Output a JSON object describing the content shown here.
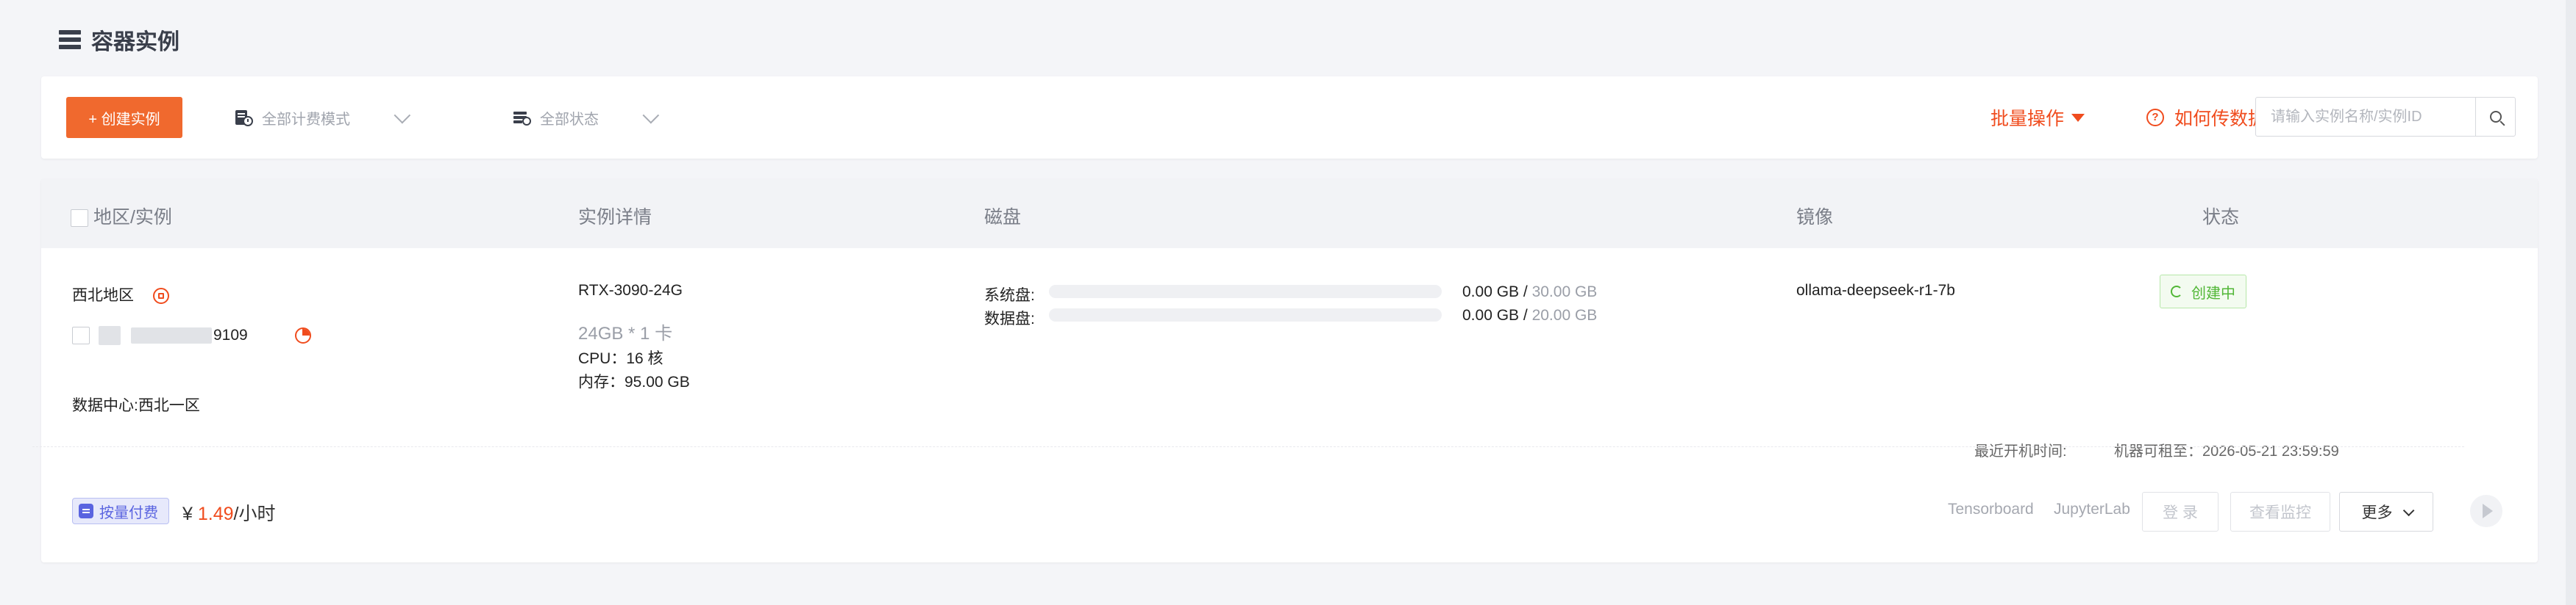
{
  "page": {
    "title": "容器实例"
  },
  "toolbar": {
    "create_label": "+ 创建实例",
    "billing_filter": "全部计费模式",
    "status_filter": "全部状态",
    "batch_label": "批量操作",
    "howto_label": "如何传数据",
    "search_placeholder": "请输入实例名称/实例ID",
    "icons": {
      "billing": "billing-filter-icon",
      "status": "status-filter-icon",
      "search": "search-icon"
    }
  },
  "table": {
    "headers": [
      "地区/实例",
      "实例详情",
      "磁盘",
      "镜像",
      "状态"
    ],
    "row": {
      "region": "西北地区",
      "instance_id_visible": "9109",
      "datacenter": "数据中心:西北一区",
      "gpu": "RTX-3090-24G",
      "gpu_spec": "24GB * 1 卡",
      "cpu": "CPU：16 核",
      "memory": "内存：95.00 GB",
      "disks": [
        {
          "label": "系统盘:",
          "used": "0.00 GB",
          "sep": " / ",
          "total": "30.00 GB",
          "usage": 0
        },
        {
          "label": "数据盘:",
          "used": "0.00 GB",
          "sep": " / ",
          "total": "20.00 GB",
          "usage": 0
        }
      ],
      "image": "ollama-deepseek-r1-7b",
      "status": "创建中",
      "last_boot_label": "最近开机时间:",
      "rent_until": "机器可租至：2026-05-21 23:59:59",
      "billing_badge": "按量付费",
      "price_prefix": "¥",
      "price_value": "1.49",
      "price_unit": "/小时",
      "actions": {
        "tensorboard": "Tensorboard",
        "jupyterlab": "JupyterLab",
        "login": "登 录",
        "monitor": "查看监控",
        "more": "更多"
      }
    }
  },
  "colors": {
    "accent": "#f0692e",
    "danger_text": "#f04c1e",
    "success": "#52b737",
    "pay_badge": "#5a64e0",
    "page_bg": "#f4f5f8"
  }
}
